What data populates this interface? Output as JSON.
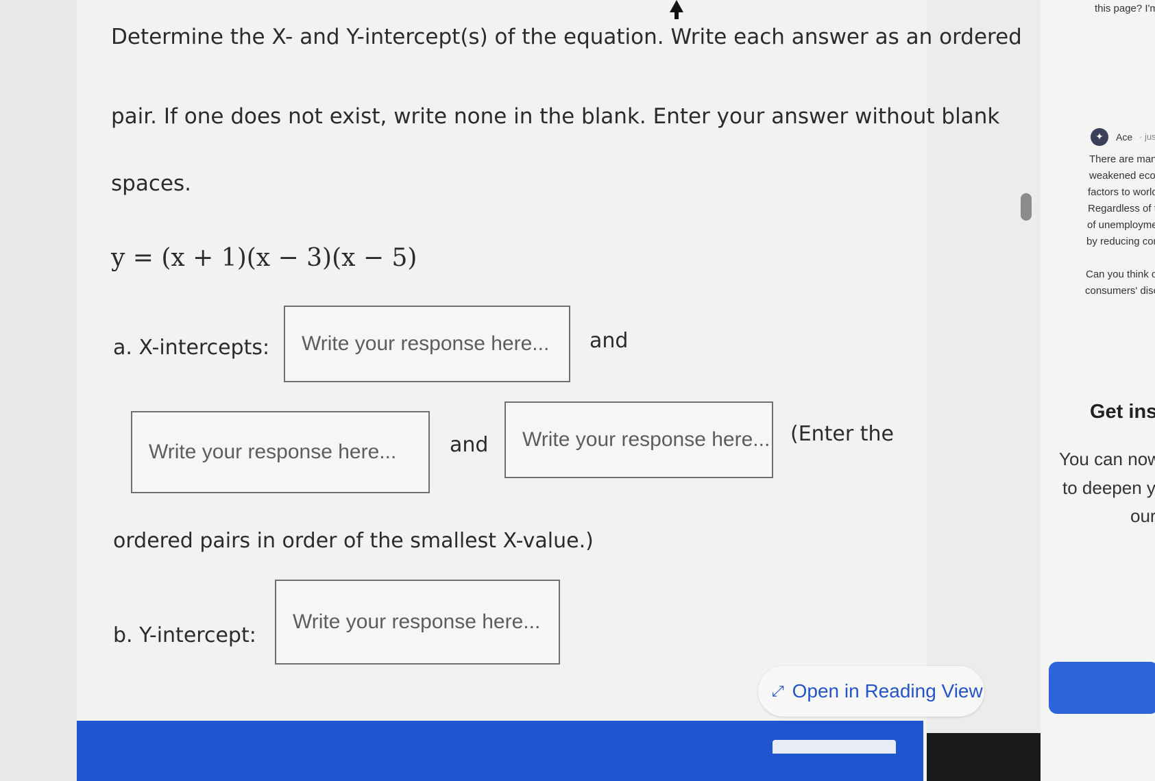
{
  "question": {
    "line1": "Determine the X- and Y-intercept(s) of the equation. Write each answer as an ordered",
    "line2": "pair. If one does not exist, write none in the blank.  Enter your answer without blank",
    "line3": "spaces.",
    "equation": "y = (x + 1)(x − 3)(x − 5)"
  },
  "part_a": {
    "label": "a. X-intercepts:",
    "and_1": "and",
    "and_2": "and",
    "enter_the": "(Enter the",
    "note": "ordered pairs in order of the smallest X-value.)"
  },
  "part_b": {
    "label": "b. Y-intercept:"
  },
  "inputs": {
    "placeholder": "Write your response here..."
  },
  "reading_view": {
    "label": "Open in Reading View",
    "icon": "expand-arrows-icon"
  },
  "right_panel": {
    "top_text": "this page? I'm",
    "author": "Ace",
    "author_meta": "· jus",
    "lines": [
      "There are many",
      "weakened econ",
      "factors to world",
      "Regardless of th",
      "of unemployme",
      "by reducing con"
    ],
    "lines2": [
      "Can you think of",
      "consumers' disc"
    ],
    "heading": "Get inst",
    "body": [
      "You can now",
      "to deepen yo",
      "our"
    ]
  },
  "colors": {
    "accent": "#1f56cf",
    "link": "#2454c7"
  }
}
